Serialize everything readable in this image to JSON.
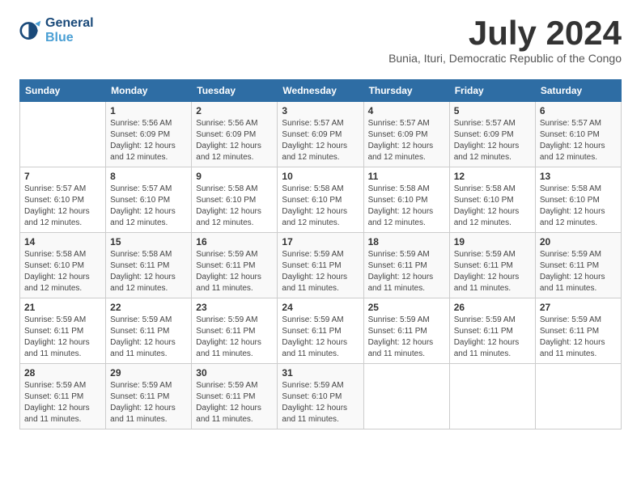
{
  "header": {
    "logo_line1": "General",
    "logo_line2": "Blue",
    "month_year": "July 2024",
    "location": "Bunia, Ituri, Democratic Republic of the Congo"
  },
  "days_of_week": [
    "Sunday",
    "Monday",
    "Tuesday",
    "Wednesday",
    "Thursday",
    "Friday",
    "Saturday"
  ],
  "weeks": [
    [
      {
        "num": "",
        "info": ""
      },
      {
        "num": "1",
        "info": "Sunrise: 5:56 AM\nSunset: 6:09 PM\nDaylight: 12 hours\nand 12 minutes."
      },
      {
        "num": "2",
        "info": "Sunrise: 5:56 AM\nSunset: 6:09 PM\nDaylight: 12 hours\nand 12 minutes."
      },
      {
        "num": "3",
        "info": "Sunrise: 5:57 AM\nSunset: 6:09 PM\nDaylight: 12 hours\nand 12 minutes."
      },
      {
        "num": "4",
        "info": "Sunrise: 5:57 AM\nSunset: 6:09 PM\nDaylight: 12 hours\nand 12 minutes."
      },
      {
        "num": "5",
        "info": "Sunrise: 5:57 AM\nSunset: 6:09 PM\nDaylight: 12 hours\nand 12 minutes."
      },
      {
        "num": "6",
        "info": "Sunrise: 5:57 AM\nSunset: 6:10 PM\nDaylight: 12 hours\nand 12 minutes."
      }
    ],
    [
      {
        "num": "7",
        "info": "Sunrise: 5:57 AM\nSunset: 6:10 PM\nDaylight: 12 hours\nand 12 minutes."
      },
      {
        "num": "8",
        "info": "Sunrise: 5:57 AM\nSunset: 6:10 PM\nDaylight: 12 hours\nand 12 minutes."
      },
      {
        "num": "9",
        "info": "Sunrise: 5:58 AM\nSunset: 6:10 PM\nDaylight: 12 hours\nand 12 minutes."
      },
      {
        "num": "10",
        "info": "Sunrise: 5:58 AM\nSunset: 6:10 PM\nDaylight: 12 hours\nand 12 minutes."
      },
      {
        "num": "11",
        "info": "Sunrise: 5:58 AM\nSunset: 6:10 PM\nDaylight: 12 hours\nand 12 minutes."
      },
      {
        "num": "12",
        "info": "Sunrise: 5:58 AM\nSunset: 6:10 PM\nDaylight: 12 hours\nand 12 minutes."
      },
      {
        "num": "13",
        "info": "Sunrise: 5:58 AM\nSunset: 6:10 PM\nDaylight: 12 hours\nand 12 minutes."
      }
    ],
    [
      {
        "num": "14",
        "info": "Sunrise: 5:58 AM\nSunset: 6:10 PM\nDaylight: 12 hours\nand 12 minutes."
      },
      {
        "num": "15",
        "info": "Sunrise: 5:58 AM\nSunset: 6:11 PM\nDaylight: 12 hours\nand 12 minutes."
      },
      {
        "num": "16",
        "info": "Sunrise: 5:59 AM\nSunset: 6:11 PM\nDaylight: 12 hours\nand 11 minutes."
      },
      {
        "num": "17",
        "info": "Sunrise: 5:59 AM\nSunset: 6:11 PM\nDaylight: 12 hours\nand 11 minutes."
      },
      {
        "num": "18",
        "info": "Sunrise: 5:59 AM\nSunset: 6:11 PM\nDaylight: 12 hours\nand 11 minutes."
      },
      {
        "num": "19",
        "info": "Sunrise: 5:59 AM\nSunset: 6:11 PM\nDaylight: 12 hours\nand 11 minutes."
      },
      {
        "num": "20",
        "info": "Sunrise: 5:59 AM\nSunset: 6:11 PM\nDaylight: 12 hours\nand 11 minutes."
      }
    ],
    [
      {
        "num": "21",
        "info": "Sunrise: 5:59 AM\nSunset: 6:11 PM\nDaylight: 12 hours\nand 11 minutes."
      },
      {
        "num": "22",
        "info": "Sunrise: 5:59 AM\nSunset: 6:11 PM\nDaylight: 12 hours\nand 11 minutes."
      },
      {
        "num": "23",
        "info": "Sunrise: 5:59 AM\nSunset: 6:11 PM\nDaylight: 12 hours\nand 11 minutes."
      },
      {
        "num": "24",
        "info": "Sunrise: 5:59 AM\nSunset: 6:11 PM\nDaylight: 12 hours\nand 11 minutes."
      },
      {
        "num": "25",
        "info": "Sunrise: 5:59 AM\nSunset: 6:11 PM\nDaylight: 12 hours\nand 11 minutes."
      },
      {
        "num": "26",
        "info": "Sunrise: 5:59 AM\nSunset: 6:11 PM\nDaylight: 12 hours\nand 11 minutes."
      },
      {
        "num": "27",
        "info": "Sunrise: 5:59 AM\nSunset: 6:11 PM\nDaylight: 12 hours\nand 11 minutes."
      }
    ],
    [
      {
        "num": "28",
        "info": "Sunrise: 5:59 AM\nSunset: 6:11 PM\nDaylight: 12 hours\nand 11 minutes."
      },
      {
        "num": "29",
        "info": "Sunrise: 5:59 AM\nSunset: 6:11 PM\nDaylight: 12 hours\nand 11 minutes."
      },
      {
        "num": "30",
        "info": "Sunrise: 5:59 AM\nSunset: 6:11 PM\nDaylight: 12 hours\nand 11 minutes."
      },
      {
        "num": "31",
        "info": "Sunrise: 5:59 AM\nSunset: 6:10 PM\nDaylight: 12 hours\nand 11 minutes."
      },
      {
        "num": "",
        "info": ""
      },
      {
        "num": "",
        "info": ""
      },
      {
        "num": "",
        "info": ""
      }
    ]
  ]
}
